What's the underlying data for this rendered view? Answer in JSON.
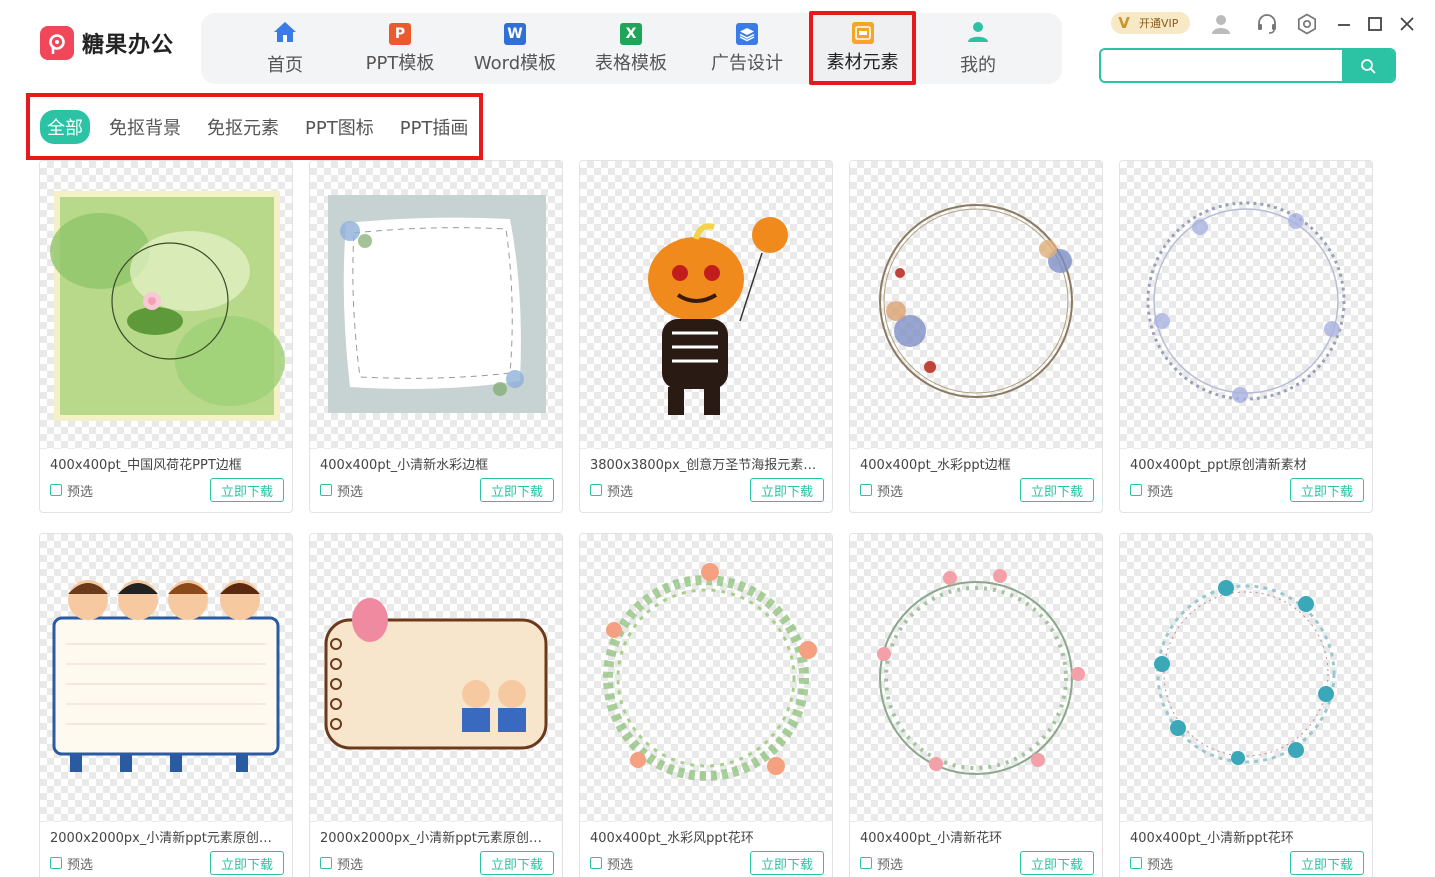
{
  "app": {
    "logo_text": "糖果办公"
  },
  "nav": {
    "items": [
      {
        "label": "首页",
        "icon": "home-icon",
        "color": "#3b7be8"
      },
      {
        "label": "PPT模板",
        "icon": "ppt-icon",
        "color": "#ea5a2c",
        "glyph": "P"
      },
      {
        "label": "Word模板",
        "icon": "word-icon",
        "color": "#2f6fd6",
        "glyph": "W"
      },
      {
        "label": "表格模板",
        "icon": "excel-icon",
        "color": "#1fa55a",
        "glyph": "X"
      },
      {
        "label": "广告设计",
        "icon": "layers-icon",
        "color": "#3b7be8"
      },
      {
        "label": "素材元素",
        "icon": "ad-material-icon",
        "color": "#f5a623",
        "active": true
      },
      {
        "label": "我的",
        "icon": "user-icon",
        "color": "#2bc3a3"
      }
    ]
  },
  "topbar": {
    "vip_label": "开通VIP",
    "search_placeholder": "",
    "search_value": ""
  },
  "subtabs": [
    "全部",
    "免抠背景",
    "免抠元素",
    "PPT图标",
    "PPT插画"
  ],
  "cards_common": {
    "preview_label": "预选",
    "download_label": "立即下载"
  },
  "cards": [
    {
      "title": "400x400pt_中国风荷花PPT边框"
    },
    {
      "title": "400x400pt_小清新水彩边框"
    },
    {
      "title": "3800x3800px_创意万圣节海报元素…"
    },
    {
      "title": "400x400pt_水彩ppt边框"
    },
    {
      "title": "400x400pt_ppt原创清新素材"
    },
    {
      "title": "2000x2000px_小清新ppt元素原创…"
    },
    {
      "title": "2000x2000px_小清新ppt元素原创…"
    },
    {
      "title": "400x400pt_水彩风ppt花环"
    },
    {
      "title": "400x400pt_小清新花环"
    },
    {
      "title": "400x400pt_小清新ppt花环"
    }
  ],
  "colors": {
    "accent": "#2bc3a3",
    "highlight": "#e6191d"
  }
}
